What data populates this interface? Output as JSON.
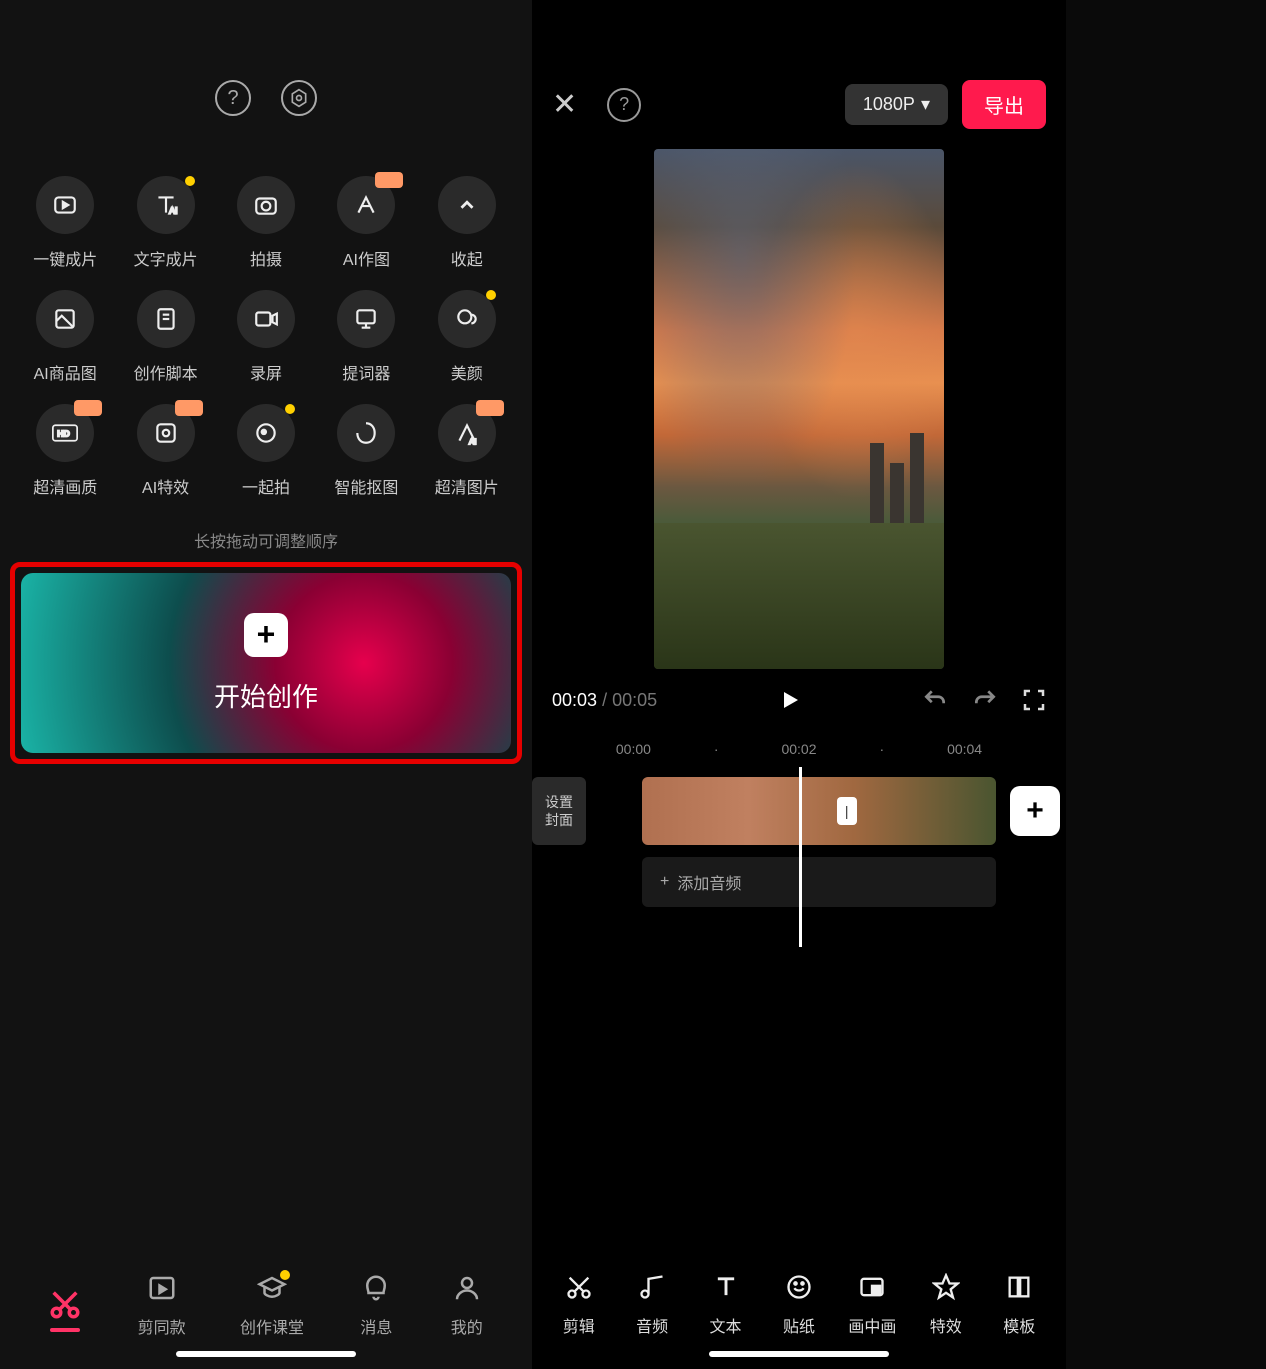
{
  "left": {
    "tools": [
      {
        "label": "一键成片",
        "name": "one-click-video",
        "badge": null
      },
      {
        "label": "文字成片",
        "name": "text-to-video",
        "badge": "dot"
      },
      {
        "label": "拍摄",
        "name": "shoot",
        "badge": null
      },
      {
        "label": "AI作图",
        "name": "ai-draw",
        "badge": "tag"
      },
      {
        "label": "收起",
        "name": "collapse",
        "badge": null
      },
      {
        "label": "AI商品图",
        "name": "ai-product",
        "badge": null
      },
      {
        "label": "创作脚本",
        "name": "script",
        "badge": null
      },
      {
        "label": "录屏",
        "name": "record-screen",
        "badge": null
      },
      {
        "label": "提词器",
        "name": "teleprompter",
        "badge": null
      },
      {
        "label": "美颜",
        "name": "beauty",
        "badge": "dot"
      },
      {
        "label": "超清画质",
        "name": "hd-quality",
        "badge": "tag"
      },
      {
        "label": "AI特效",
        "name": "ai-effect",
        "badge": "tag"
      },
      {
        "label": "一起拍",
        "name": "shoot-together",
        "badge": "dot"
      },
      {
        "label": "智能抠图",
        "name": "smart-cutout",
        "badge": null
      },
      {
        "label": "超清图片",
        "name": "hd-image",
        "badge": "tag"
      }
    ],
    "hint": "长按拖动可调整顺序",
    "create_label": "开始创作",
    "nav": [
      {
        "label": "",
        "name": "cut",
        "active": true
      },
      {
        "label": "剪同款",
        "name": "same-style"
      },
      {
        "label": "创作课堂",
        "name": "academy",
        "badge": "dot"
      },
      {
        "label": "消息",
        "name": "messages"
      },
      {
        "label": "我的",
        "name": "mine"
      }
    ]
  },
  "right": {
    "resolution": "1080P",
    "export": "导出",
    "current_time": "00:03",
    "total_time": "00:05",
    "ruler": [
      "00:00",
      "·",
      "00:02",
      "·",
      "00:04"
    ],
    "cover_btn": "设置\n封面",
    "add_audio": "添加音频",
    "toolbar": [
      {
        "label": "剪辑",
        "name": "edit"
      },
      {
        "label": "音频",
        "name": "audio"
      },
      {
        "label": "文本",
        "name": "text"
      },
      {
        "label": "贴纸",
        "name": "sticker"
      },
      {
        "label": "画中画",
        "name": "pip"
      },
      {
        "label": "特效",
        "name": "effect"
      },
      {
        "label": "模板",
        "name": "template"
      }
    ]
  }
}
